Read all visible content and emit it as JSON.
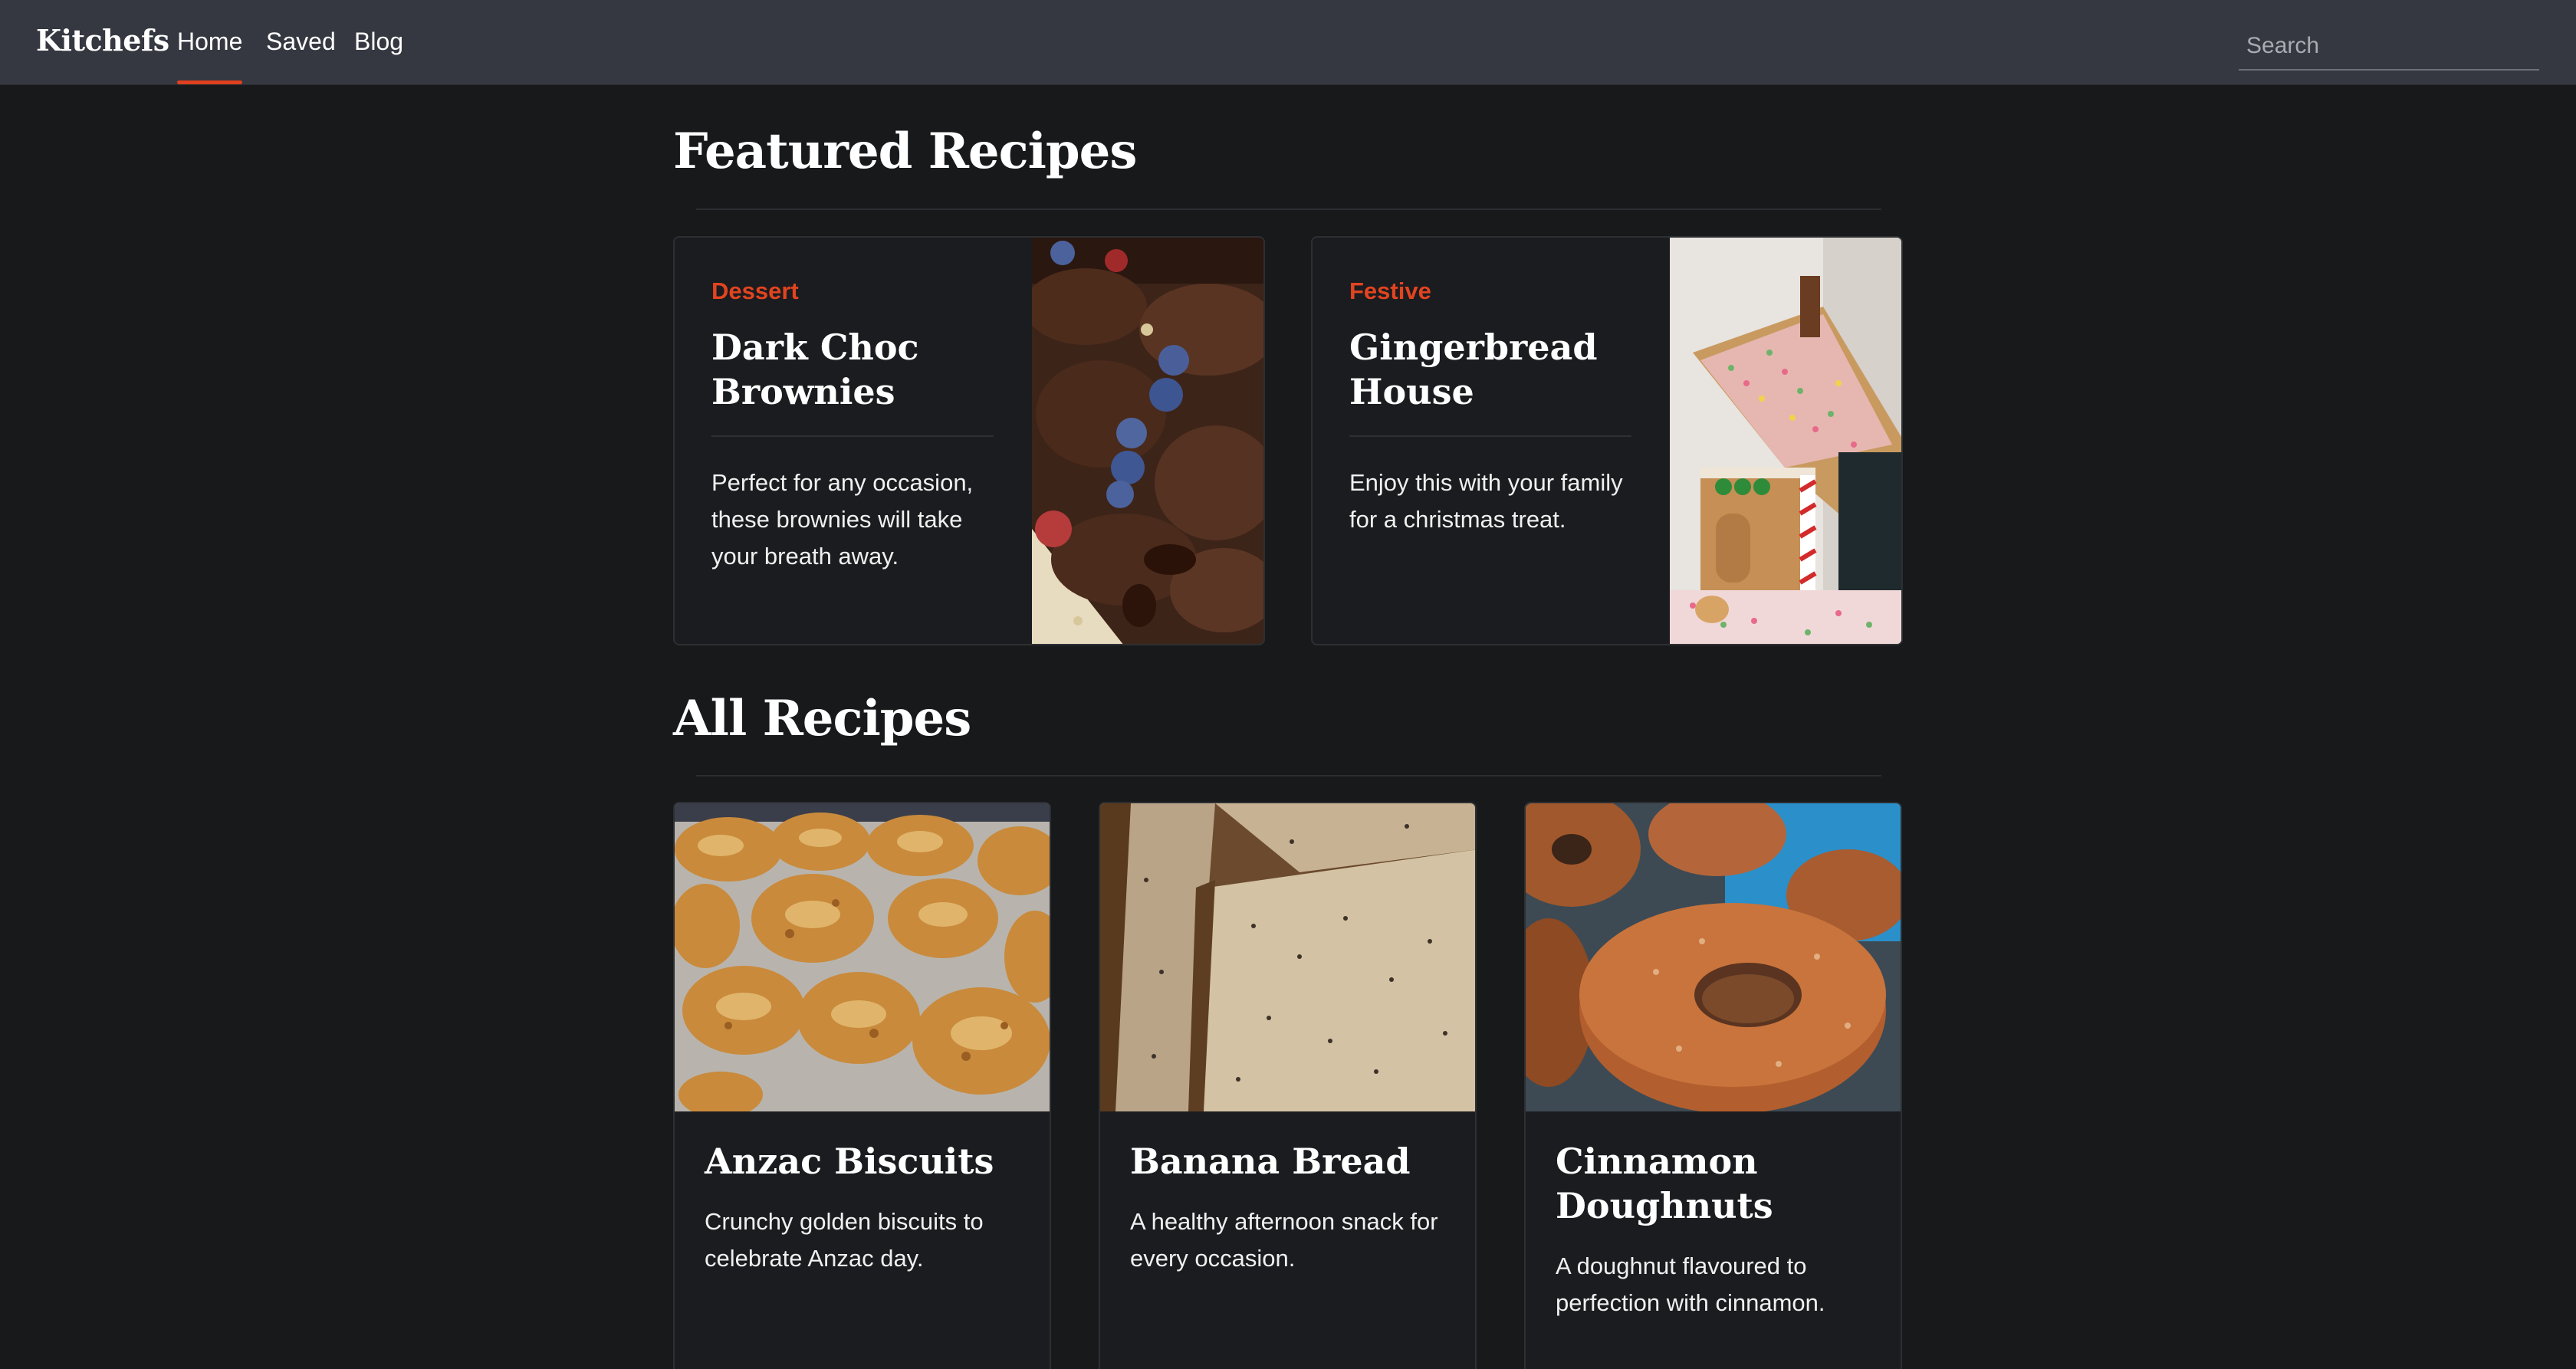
{
  "nav": {
    "brand": "Kitchefs",
    "links": [
      "Home",
      "Saved",
      "Blog"
    ],
    "active": "Home",
    "search_placeholder": "Search"
  },
  "featured": {
    "heading": "Featured Recipes",
    "cards": [
      {
        "category": "Dessert",
        "title": "Dark Choc Brownies",
        "description": "Perfect for any occasion, these brownies will take your breath away.",
        "image_icon": "brownies-photo"
      },
      {
        "category": "Festive",
        "title": "Gingerbread House",
        "description": "Enjoy this with your family for a christmas treat.",
        "image_icon": "gingerbread-house-photo"
      }
    ]
  },
  "all": {
    "heading": "All Recipes",
    "cards": [
      {
        "title": "Anzac Biscuits",
        "description": "Crunchy golden biscuits to celebrate Anzac day.",
        "image_icon": "anzac-biscuits-photo"
      },
      {
        "title": "Banana Bread",
        "description": "A healthy afternoon snack for every occasion.",
        "image_icon": "banana-bread-photo"
      },
      {
        "title": "Cinnamon Doughnuts",
        "description": "A doughnut flavoured to perfection with cinnamon.",
        "image_icon": "cinnamon-doughnuts-photo"
      }
    ]
  },
  "colors": {
    "accent": "#e24420",
    "navbar": "#353840",
    "background": "#18191b",
    "card": "#1b1c1f"
  }
}
